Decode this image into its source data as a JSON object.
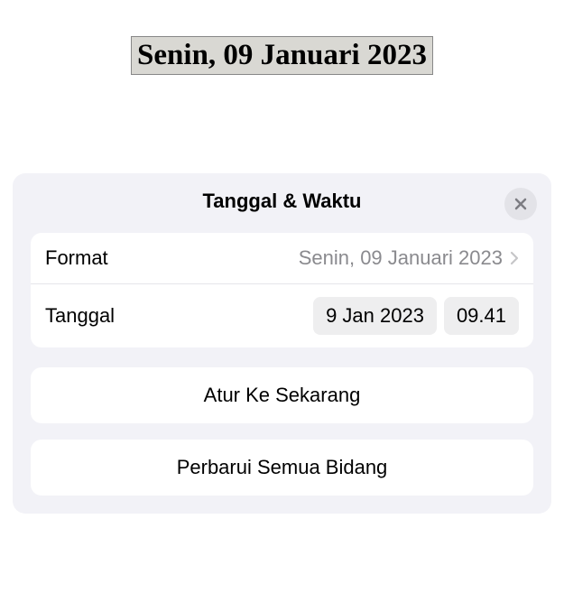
{
  "document": {
    "selected_text": "Senin, 09 Januari 2023"
  },
  "popup": {
    "title": "Tanggal & Waktu",
    "format": {
      "label": "Format",
      "value": "Senin, 09 Januari 2023"
    },
    "date": {
      "label": "Tanggal",
      "date_value": "9 Jan 2023",
      "time_value": "09.41"
    },
    "set_now_label": "Atur Ke Sekarang",
    "update_all_label": "Perbarui Semua Bidang"
  }
}
